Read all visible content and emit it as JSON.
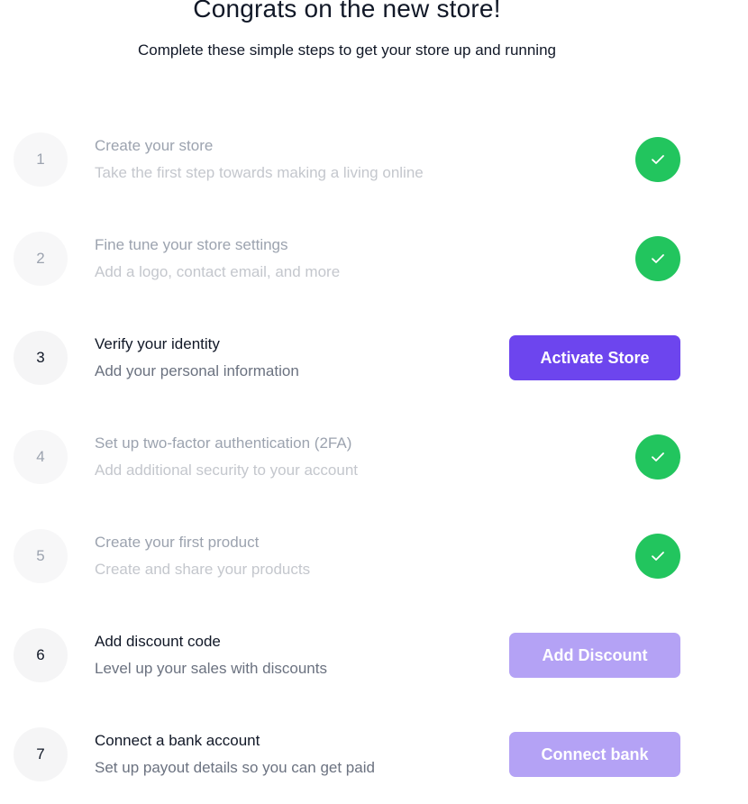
{
  "header": {
    "title": "Congrats on the new store!",
    "subtitle": "Complete these simple steps to get your store up and running"
  },
  "colors": {
    "accent": "#6d45ee",
    "accent_muted": "#b4a2f5",
    "success": "#22c55e"
  },
  "steps": [
    {
      "number": "1",
      "title": "Create your store",
      "description": "Take the first step towards making a living online",
      "status": "complete",
      "icon": "check-icon"
    },
    {
      "number": "2",
      "title": "Fine tune your store settings",
      "description": "Add a logo, contact email, and more",
      "status": "complete",
      "icon": "check-icon"
    },
    {
      "number": "3",
      "title": "Verify your identity",
      "description": "Add your personal information",
      "status": "pending",
      "action_label": "Activate Store"
    },
    {
      "number": "4",
      "title": "Set up two-factor authentication (2FA)",
      "description": "Add additional security to your account",
      "status": "complete",
      "icon": "check-icon"
    },
    {
      "number": "5",
      "title": "Create your first product",
      "description": "Create and share your products",
      "status": "complete",
      "icon": "check-icon"
    },
    {
      "number": "6",
      "title": "Add discount code",
      "description": "Level up your sales with discounts",
      "status": "pending",
      "action_label": "Add Discount"
    },
    {
      "number": "7",
      "title": "Connect a bank account",
      "description": "Set up payout details so you can get paid",
      "status": "pending",
      "action_label": "Connect bank"
    }
  ]
}
